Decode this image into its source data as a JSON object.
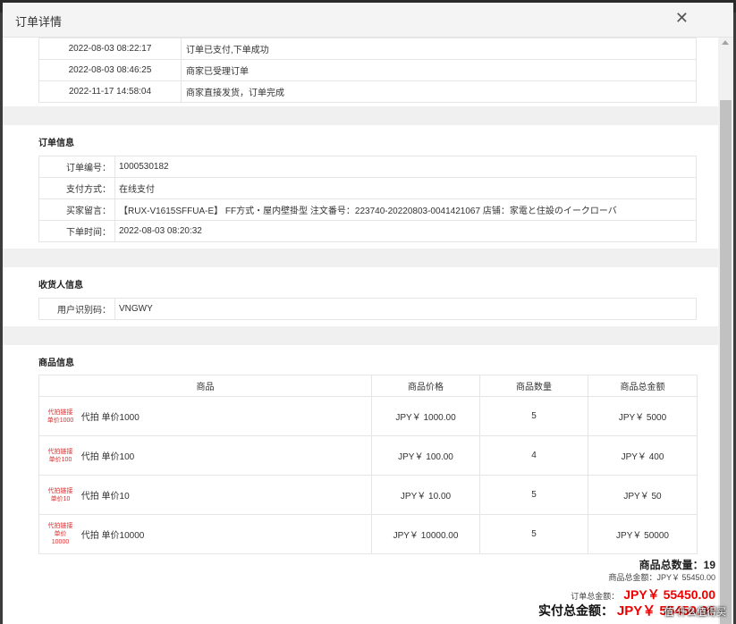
{
  "dialog": {
    "title": "订单详情",
    "close_symbol": "✕"
  },
  "order_log": [
    {
      "time": "2022-08-03 08:22:17",
      "message": "订单已支付,下单成功"
    },
    {
      "time": "2022-08-03 08:46:25",
      "message": "商家已受理订单"
    },
    {
      "time": "2022-11-17 14:58:04",
      "message": "商家直接发货，订单完成"
    }
  ],
  "order_info": {
    "title": "订单信息",
    "order_no_label": "订单编号：",
    "order_no": "1000530182",
    "payment_label": "支付方式：",
    "payment": "在线支付",
    "buyer_note_label": "买家留言：",
    "buyer_note": "【RUX-V1615SFFUA-E】 FF方式・屋内壁掛型 注文番号：223740-20220803-0041421067 店铺：家電と住設のイークローバ",
    "order_time_label": "下单时间：",
    "order_time": "2022-08-03 08:20:32"
  },
  "receiver_info": {
    "title": "收货人信息",
    "user_id_label": "用户识别码：",
    "user_id": "VNGWY"
  },
  "goods": {
    "title": "商品信息",
    "headers": [
      "商品",
      "商品价格",
      "商品数量",
      "商品总金额"
    ],
    "rows": [
      {
        "thumb": "代拍链接\n单价1000",
        "name": "代拍 单价1000",
        "price": "JPY￥ 1000.00",
        "qty": "5",
        "total": "JPY￥ 5000"
      },
      {
        "thumb": "代拍链接\n单价100",
        "name": "代拍 单价100",
        "price": "JPY￥ 100.00",
        "qty": "4",
        "total": "JPY￥ 400"
      },
      {
        "thumb": "代拍链接\n单价10",
        "name": "代拍 单价10",
        "price": "JPY￥ 10.00",
        "qty": "5",
        "total": "JPY￥ 50"
      },
      {
        "thumb": "代拍链接\n单价10000",
        "name": "代拍 单价10000",
        "price": "JPY￥ 10000.00",
        "qty": "5",
        "total": "JPY￥ 50000"
      }
    ]
  },
  "summary": {
    "total_qty_label": "商品总数量：",
    "total_qty": "19",
    "goods_total_label": "商品总金额：",
    "goods_total": "JPY￥ 55450.00",
    "order_total_label": "订单总金额：",
    "order_total": "JPY￥ 55450.00",
    "paid_total_label": "实付总金额：",
    "paid_total": "JPY￥ 55450.00"
  },
  "watermark": "值·什么值得买",
  "colors": {
    "price_red": "#ee0000",
    "section_band": "#f0f0f0"
  }
}
